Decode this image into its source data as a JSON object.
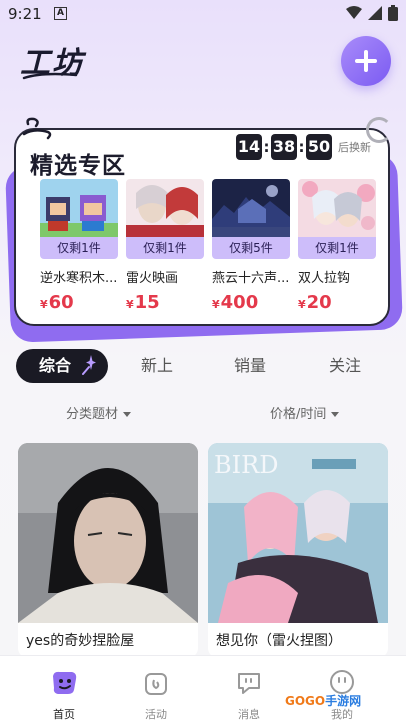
{
  "status": {
    "time": "9:21",
    "notif_glyph": "A"
  },
  "header": {
    "title": "工坊",
    "add_icon": "plus-icon"
  },
  "featured": {
    "title": "精选专区",
    "countdown": {
      "h": "14",
      "m": "38",
      "s": "50",
      "suffix": "后换新"
    },
    "items": [
      {
        "name": "逆水寒积木...",
        "stock": "仅剩1件",
        "currency": "¥",
        "price": "60"
      },
      {
        "name": "雷火映画",
        "stock": "仅剩1件",
        "currency": "¥",
        "price": "15"
      },
      {
        "name": "燕云十六声...",
        "stock": "仅剩5件",
        "currency": "¥",
        "price": "400"
      },
      {
        "name": "双人拉钩",
        "stock": "仅剩1件",
        "currency": "¥",
        "price": "20"
      }
    ]
  },
  "tabs": [
    {
      "label": "综合"
    },
    {
      "label": "新上"
    },
    {
      "label": "销量"
    },
    {
      "label": "关注"
    }
  ],
  "filters": {
    "category": "分类题材",
    "sort": "价格/时间"
  },
  "feed": [
    {
      "title": "yes的奇妙捏脸屋"
    },
    {
      "title": "想见你（雷火捏图）",
      "image_text": "BIRD"
    }
  ],
  "bottom_nav": [
    {
      "label": "首页",
      "icon": "home-icon"
    },
    {
      "label": "活动",
      "icon": "activity-icon"
    },
    {
      "label": "消息",
      "icon": "message-icon"
    },
    {
      "label": "我的",
      "icon": "profile-icon"
    }
  ],
  "watermark": {
    "text_a": "GOGO",
    "text_b": "手游网"
  },
  "colors": {
    "accent": "#8f6cf0",
    "price": "#e4394b",
    "tag_bg": "#cdbdfa",
    "dark": "#1a1a24"
  }
}
